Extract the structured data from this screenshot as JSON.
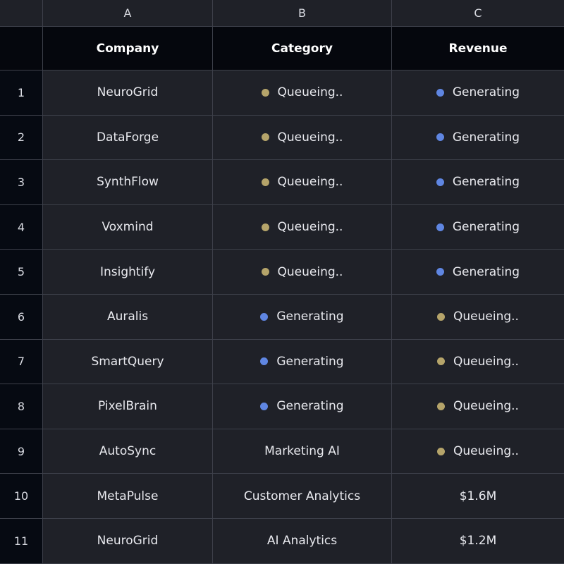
{
  "colors": {
    "queueing": "#b5a46a",
    "generating": "#5f86e2"
  },
  "columns": [
    "A",
    "B",
    "C"
  ],
  "headers": [
    "Company",
    "Category",
    "Revenue"
  ],
  "rows": [
    {
      "num": "1",
      "company": "NeuroGrid",
      "category": {
        "text": "Queueing..",
        "status": "queueing"
      },
      "revenue": {
        "text": "Generating",
        "status": "generating"
      }
    },
    {
      "num": "2",
      "company": "DataForge",
      "category": {
        "text": "Queueing..",
        "status": "queueing"
      },
      "revenue": {
        "text": "Generating",
        "status": "generating"
      }
    },
    {
      "num": "3",
      "company": "SynthFlow",
      "category": {
        "text": "Queueing..",
        "status": "queueing"
      },
      "revenue": {
        "text": "Generating",
        "status": "generating"
      }
    },
    {
      "num": "4",
      "company": "Voxmind",
      "category": {
        "text": "Queueing..",
        "status": "queueing"
      },
      "revenue": {
        "text": "Generating",
        "status": "generating"
      }
    },
    {
      "num": "5",
      "company": "Insightify",
      "category": {
        "text": "Queueing..",
        "status": "queueing"
      },
      "revenue": {
        "text": "Generating",
        "status": "generating"
      }
    },
    {
      "num": "6",
      "company": "Auralis",
      "category": {
        "text": "Generating",
        "status": "generating"
      },
      "revenue": {
        "text": "Queueing..",
        "status": "queueing"
      }
    },
    {
      "num": "7",
      "company": "SmartQuery",
      "category": {
        "text": "Generating",
        "status": "generating"
      },
      "revenue": {
        "text": "Queueing..",
        "status": "queueing"
      }
    },
    {
      "num": "8",
      "company": "PixelBrain",
      "category": {
        "text": "Generating",
        "status": "generating"
      },
      "revenue": {
        "text": "Queueing..",
        "status": "queueing"
      }
    },
    {
      "num": "9",
      "company": "AutoSync",
      "category": {
        "text": "Marketing AI",
        "status": null
      },
      "revenue": {
        "text": "Queueing..",
        "status": "queueing"
      }
    },
    {
      "num": "10",
      "company": "MetaPulse",
      "category": {
        "text": "Customer Analytics",
        "status": null
      },
      "revenue": {
        "text": "$1.6M",
        "status": null
      }
    },
    {
      "num": "11",
      "company": "NeuroGrid",
      "category": {
        "text": "AI Analytics",
        "status": null
      },
      "revenue": {
        "text": "$1.2M",
        "status": null
      }
    }
  ]
}
